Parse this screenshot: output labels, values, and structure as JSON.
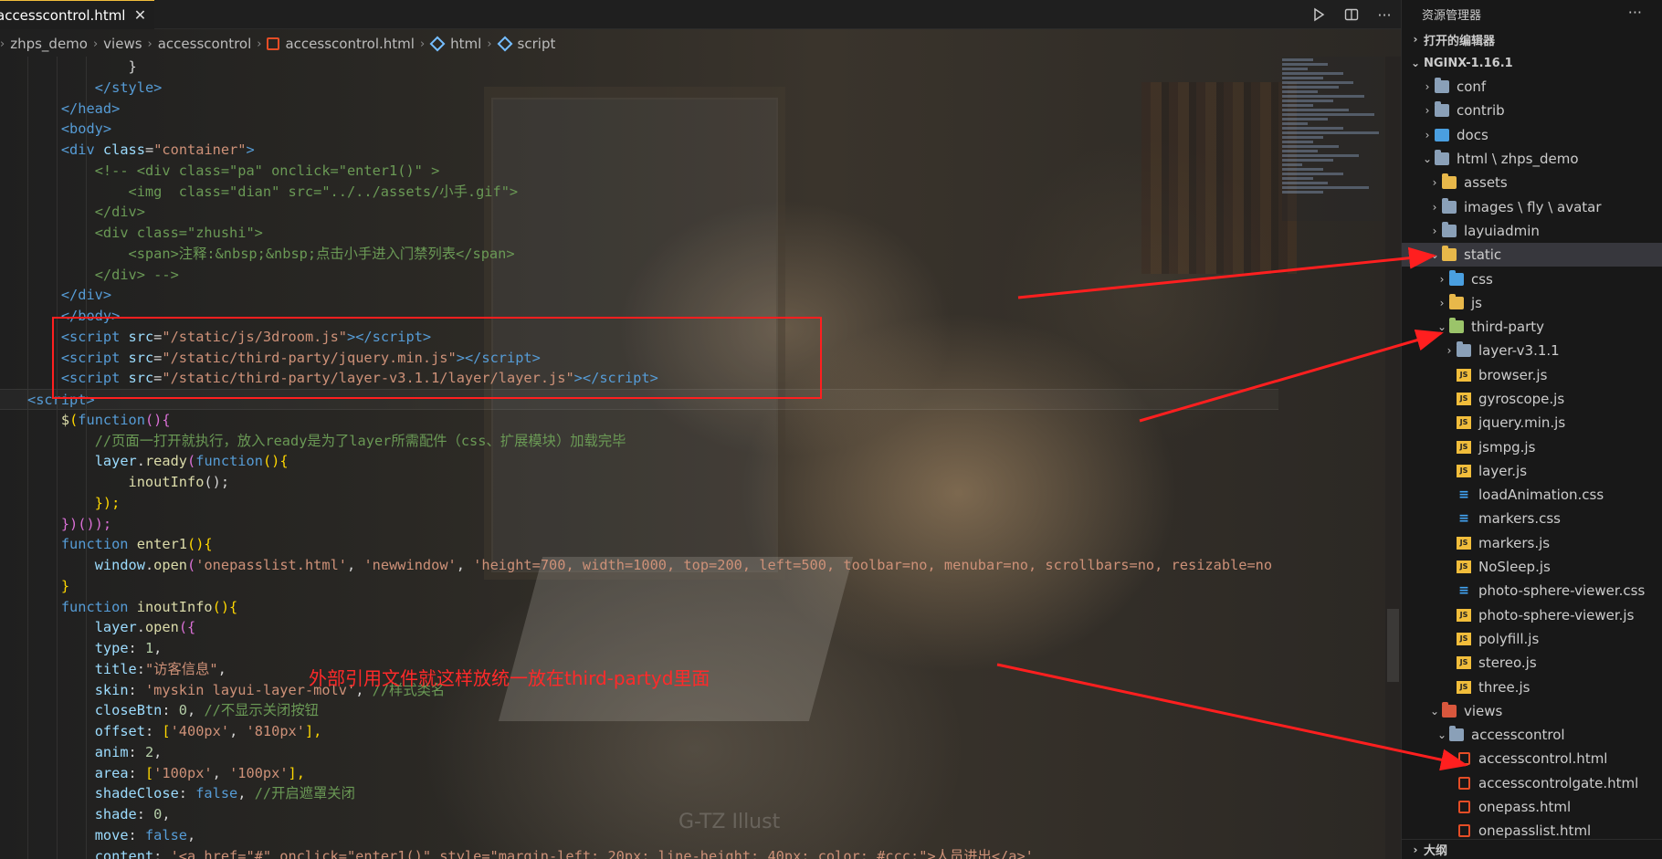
{
  "tab": {
    "label": "accesscontrol.html",
    "close": "✕"
  },
  "editor_actions": [
    "run-icon",
    "split-icon",
    "more-icon"
  ],
  "breadcrumb": [
    {
      "label": "zhps_demo"
    },
    {
      "label": "views"
    },
    {
      "label": "accesscontrol"
    },
    {
      "label": "accesscontrol.html"
    },
    {
      "label": "html"
    },
    {
      "label": "script"
    }
  ],
  "code_lines": [
    [
      {
        "t": "            ",
        "c": "txt"
      },
      {
        "t": "}",
        "c": "txt"
      }
    ],
    [
      {
        "t": "        ",
        "c": "txt"
      },
      {
        "t": "</style>",
        "c": "tag"
      }
    ],
    [
      {
        "t": "    ",
        "c": "txt"
      },
      {
        "t": "</head>",
        "c": "tag"
      }
    ],
    [
      {
        "t": "    ",
        "c": "txt"
      },
      {
        "t": "<body>",
        "c": "tag"
      }
    ],
    [
      {
        "t": "    ",
        "c": "txt"
      },
      {
        "t": "<div ",
        "c": "tag"
      },
      {
        "t": "class",
        "c": "attr"
      },
      {
        "t": "=",
        "c": "pun"
      },
      {
        "t": "\"container\"",
        "c": "str"
      },
      {
        "t": ">",
        "c": "tag"
      }
    ],
    [
      {
        "t": "        ",
        "c": "txt"
      },
      {
        "t": "<!-- <div class=\"pa\" onclick=\"enter1()\" >",
        "c": "cmt"
      }
    ],
    [
      {
        "t": "            ",
        "c": "txt"
      },
      {
        "t": "<img  class=\"dian\" src=\"../../assets/小手.gif\">",
        "c": "cmt"
      }
    ],
    [
      {
        "t": "        ",
        "c": "txt"
      },
      {
        "t": "</div>",
        "c": "cmt"
      }
    ],
    [
      {
        "t": "        ",
        "c": "txt"
      },
      {
        "t": "<div class=\"zhushi\">",
        "c": "cmt"
      }
    ],
    [
      {
        "t": "            ",
        "c": "txt"
      },
      {
        "t": "<span>注释:&nbsp;&nbsp;点击小手进入门禁列表</span>",
        "c": "cmt"
      }
    ],
    [
      {
        "t": "        ",
        "c": "txt"
      },
      {
        "t": "</div> -->",
        "c": "cmt"
      }
    ],
    [
      {
        "t": "    ",
        "c": "txt"
      },
      {
        "t": "</div>",
        "c": "tag"
      }
    ],
    [
      {
        "t": "    ",
        "c": "txt"
      },
      {
        "t": "</body>",
        "c": "tag"
      }
    ],
    [
      {
        "t": "    ",
        "c": "txt"
      },
      {
        "t": "<script ",
        "c": "tag"
      },
      {
        "t": "src",
        "c": "attr"
      },
      {
        "t": "=",
        "c": "pun"
      },
      {
        "t": "\"/static/js/3droom.js\"",
        "c": "str"
      },
      {
        "t": "></",
        "c": "tag"
      },
      {
        "t": "script",
        "c": "tag"
      },
      {
        "t": ">",
        "c": "tag"
      }
    ],
    [
      {
        "t": "    ",
        "c": "txt"
      },
      {
        "t": "<script ",
        "c": "tag"
      },
      {
        "t": "src",
        "c": "attr"
      },
      {
        "t": "=",
        "c": "pun"
      },
      {
        "t": "\"/static/third-party/jquery.min.js\"",
        "c": "str"
      },
      {
        "t": "></",
        "c": "tag"
      },
      {
        "t": "script",
        "c": "tag"
      },
      {
        "t": ">",
        "c": "tag"
      }
    ],
    [
      {
        "t": "    ",
        "c": "txt"
      },
      {
        "t": "<script ",
        "c": "tag"
      },
      {
        "t": "src",
        "c": "attr"
      },
      {
        "t": "=",
        "c": "pun"
      },
      {
        "t": "\"/static/third-party/layer-v3.1.1/layer/layer.js\"",
        "c": "str"
      },
      {
        "t": "></",
        "c": "tag"
      },
      {
        "t": "script",
        "c": "tag"
      },
      {
        "t": ">",
        "c": "tag"
      }
    ],
    [
      {
        "t": "<",
        "c": "tag"
      },
      {
        "t": "script",
        "c": "tag"
      },
      {
        "t": ">",
        "c": "tag"
      }
    ],
    [
      {
        "t": "    ",
        "c": "txt"
      },
      {
        "t": "$",
        "c": "fn"
      },
      {
        "t": "(",
        "c": "yel"
      },
      {
        "t": "function",
        "c": "kw"
      },
      {
        "t": "(){",
        "c": "pink"
      }
    ],
    [
      {
        "t": "        ",
        "c": "txt"
      },
      {
        "t": "//页面一打开就执行，放入ready是为了layer所需配件（css、扩展模块）加载完毕",
        "c": "cmt"
      }
    ],
    [
      {
        "t": "        ",
        "c": "txt"
      },
      {
        "t": "layer",
        "c": "attr"
      },
      {
        "t": ".",
        "c": "pun"
      },
      {
        "t": "ready",
        "c": "fn"
      },
      {
        "t": "(",
        "c": "pink"
      },
      {
        "t": "function",
        "c": "kw"
      },
      {
        "t": "(){",
        "c": "yel"
      }
    ],
    [
      {
        "t": "            ",
        "c": "txt"
      },
      {
        "t": "inoutInfo",
        "c": "fn"
      },
      {
        "t": "();",
        "c": "pun"
      }
    ],
    [
      {
        "t": "        ",
        "c": "txt"
      },
      {
        "t": "});",
        "c": "yel"
      }
    ],
    [
      {
        "t": "    ",
        "c": "txt"
      },
      {
        "t": "})());",
        "c": "pink"
      }
    ],
    [
      {
        "t": "    ",
        "c": "txt"
      },
      {
        "t": "function ",
        "c": "kw"
      },
      {
        "t": "enter1",
        "c": "fn"
      },
      {
        "t": "(){",
        "c": "yel"
      }
    ],
    [
      {
        "t": "        ",
        "c": "txt"
      },
      {
        "t": "window",
        "c": "attr"
      },
      {
        "t": ".",
        "c": "pun"
      },
      {
        "t": "open",
        "c": "fn"
      },
      {
        "t": "(",
        "c": "pink"
      },
      {
        "t": "'onepasslist.html'",
        "c": "str"
      },
      {
        "t": ", ",
        "c": "pun"
      },
      {
        "t": "'newwindow'",
        "c": "str"
      },
      {
        "t": ", ",
        "c": "pun"
      },
      {
        "t": "'height=700, width=1000, top=200, left=500, toolbar=no, menubar=no, scrollbars=no, resizable=no",
        "c": "str"
      }
    ],
    [
      {
        "t": "    ",
        "c": "txt"
      },
      {
        "t": "}",
        "c": "yel"
      }
    ],
    [
      {
        "t": "    ",
        "c": "txt"
      },
      {
        "t": "function ",
        "c": "kw"
      },
      {
        "t": "inoutInfo",
        "c": "fn"
      },
      {
        "t": "(){",
        "c": "yel"
      }
    ],
    [
      {
        "t": "        ",
        "c": "txt"
      },
      {
        "t": "layer",
        "c": "attr"
      },
      {
        "t": ".",
        "c": "pun"
      },
      {
        "t": "open",
        "c": "fn"
      },
      {
        "t": "({",
        "c": "pink"
      }
    ],
    [
      {
        "t": "        ",
        "c": "txt"
      },
      {
        "t": "type",
        "c": "attr"
      },
      {
        "t": ": ",
        "c": "pun"
      },
      {
        "t": "1",
        "c": "num"
      },
      {
        "t": ",",
        "c": "pun"
      }
    ],
    [
      {
        "t": "        ",
        "c": "txt"
      },
      {
        "t": "title",
        "c": "attr"
      },
      {
        "t": ":",
        "c": "pun"
      },
      {
        "t": "\"访客信息\"",
        "c": "str"
      },
      {
        "t": ",",
        "c": "pun"
      }
    ],
    [
      {
        "t": "        ",
        "c": "txt"
      },
      {
        "t": "skin",
        "c": "attr"
      },
      {
        "t": ": ",
        "c": "pun"
      },
      {
        "t": "'myskin layui-layer-molv'",
        "c": "str"
      },
      {
        "t": ", ",
        "c": "pun"
      },
      {
        "t": "//样式类名",
        "c": "cmt"
      }
    ],
    [
      {
        "t": "        ",
        "c": "txt"
      },
      {
        "t": "closeBtn",
        "c": "attr"
      },
      {
        "t": ": ",
        "c": "pun"
      },
      {
        "t": "0",
        "c": "num"
      },
      {
        "t": ", ",
        "c": "pun"
      },
      {
        "t": "//不显示关闭按钮",
        "c": "cmt"
      }
    ],
    [
      {
        "t": "        ",
        "c": "txt"
      },
      {
        "t": "offset",
        "c": "attr"
      },
      {
        "t": ": ",
        "c": "pun"
      },
      {
        "t": "[",
        "c": "yel"
      },
      {
        "t": "'400px'",
        "c": "str"
      },
      {
        "t": ", ",
        "c": "pun"
      },
      {
        "t": "'810px'",
        "c": "str"
      },
      {
        "t": "],",
        "c": "yel"
      }
    ],
    [
      {
        "t": "        ",
        "c": "txt"
      },
      {
        "t": "anim",
        "c": "attr"
      },
      {
        "t": ": ",
        "c": "pun"
      },
      {
        "t": "2",
        "c": "num"
      },
      {
        "t": ",",
        "c": "pun"
      }
    ],
    [
      {
        "t": "        ",
        "c": "txt"
      },
      {
        "t": "area",
        "c": "attr"
      },
      {
        "t": ": ",
        "c": "pun"
      },
      {
        "t": "[",
        "c": "yel"
      },
      {
        "t": "'100px'",
        "c": "str"
      },
      {
        "t": ", ",
        "c": "pun"
      },
      {
        "t": "'100px'",
        "c": "str"
      },
      {
        "t": "],",
        "c": "yel"
      }
    ],
    [
      {
        "t": "        ",
        "c": "txt"
      },
      {
        "t": "shadeClose",
        "c": "attr"
      },
      {
        "t": ": ",
        "c": "pun"
      },
      {
        "t": "false",
        "c": "kw"
      },
      {
        "t": ", ",
        "c": "pun"
      },
      {
        "t": "//开启遮罩关闭",
        "c": "cmt"
      }
    ],
    [
      {
        "t": "        ",
        "c": "txt"
      },
      {
        "t": "shade",
        "c": "attr"
      },
      {
        "t": ": ",
        "c": "pun"
      },
      {
        "t": "0",
        "c": "num"
      },
      {
        "t": ",",
        "c": "pun"
      }
    ],
    [
      {
        "t": "        ",
        "c": "txt"
      },
      {
        "t": "move",
        "c": "attr"
      },
      {
        "t": ": ",
        "c": "pun"
      },
      {
        "t": "false",
        "c": "kw"
      },
      {
        "t": ",",
        "c": "pun"
      }
    ],
    [
      {
        "t": "        ",
        "c": "txt"
      },
      {
        "t": "content",
        "c": "attr"
      },
      {
        "t": ": ",
        "c": "pun"
      },
      {
        "t": "'<a href=\"#\" onclick=\"enter1()\" style=\"margin-left: 20px; line-height: 40px; color: #ccc;\">人员进出</a>'",
        "c": "str"
      }
    ]
  ],
  "annotation_text": "外部引用文件就这样放统一放在third-partyd里面",
  "watermark": "G-TZ Illust",
  "explorer": {
    "title": "资源管理器",
    "open_editors": "打开的编辑器",
    "root": "NGINX-1.16.1",
    "outline": "大纲",
    "items": [
      {
        "label": "conf",
        "indent": 1,
        "chev": "›",
        "icon": "folder",
        "color": "plain"
      },
      {
        "label": "contrib",
        "indent": 1,
        "chev": "›",
        "icon": "folder",
        "color": "plain"
      },
      {
        "label": "docs",
        "indent": 1,
        "chev": "›",
        "icon": "docs",
        "color": "blue"
      },
      {
        "label": "html \\ zhps_demo",
        "indent": 1,
        "chev": "⌄",
        "icon": "folder",
        "color": "plain"
      },
      {
        "label": "assets",
        "indent": 2,
        "chev": "›",
        "icon": "folder",
        "color": "yellow"
      },
      {
        "label": "images \\ fly \\ avatar",
        "indent": 2,
        "chev": "›",
        "icon": "folder",
        "color": "plain"
      },
      {
        "label": "layuiadmin",
        "indent": 2,
        "chev": "›",
        "icon": "folder",
        "color": "plain"
      },
      {
        "label": "static",
        "indent": 2,
        "chev": "⌄",
        "icon": "folder",
        "color": "yellow",
        "selected": true
      },
      {
        "label": "css",
        "indent": 3,
        "chev": "›",
        "icon": "folder",
        "color": "blue"
      },
      {
        "label": "js",
        "indent": 3,
        "chev": "›",
        "icon": "folder",
        "color": "yellow"
      },
      {
        "label": "third-party",
        "indent": 3,
        "chev": "⌄",
        "icon": "folder",
        "color": "green"
      },
      {
        "label": "layer-v3.1.1",
        "indent": 4,
        "chev": "›",
        "icon": "folder",
        "color": "plain"
      },
      {
        "label": "browser.js",
        "indent": 4,
        "chev": "",
        "icon": "js"
      },
      {
        "label": "gyroscope.js",
        "indent": 4,
        "chev": "",
        "icon": "js"
      },
      {
        "label": "jquery.min.js",
        "indent": 4,
        "chev": "",
        "icon": "js"
      },
      {
        "label": "jsmpg.js",
        "indent": 4,
        "chev": "",
        "icon": "js"
      },
      {
        "label": "layer.js",
        "indent": 4,
        "chev": "",
        "icon": "js"
      },
      {
        "label": "loadAnimation.css",
        "indent": 4,
        "chev": "",
        "icon": "css"
      },
      {
        "label": "markers.css",
        "indent": 4,
        "chev": "",
        "icon": "css"
      },
      {
        "label": "markers.js",
        "indent": 4,
        "chev": "",
        "icon": "js"
      },
      {
        "label": "NoSleep.js",
        "indent": 4,
        "chev": "",
        "icon": "js"
      },
      {
        "label": "photo-sphere-viewer.css",
        "indent": 4,
        "chev": "",
        "icon": "css"
      },
      {
        "label": "photo-sphere-viewer.js",
        "indent": 4,
        "chev": "",
        "icon": "js"
      },
      {
        "label": "polyfill.js",
        "indent": 4,
        "chev": "",
        "icon": "js"
      },
      {
        "label": "stereo.js",
        "indent": 4,
        "chev": "",
        "icon": "js"
      },
      {
        "label": "three.js",
        "indent": 4,
        "chev": "",
        "icon": "js"
      },
      {
        "label": "views",
        "indent": 2,
        "chev": "⌄",
        "icon": "folder",
        "color": "red"
      },
      {
        "label": "accesscontrol",
        "indent": 3,
        "chev": "⌄",
        "icon": "folder",
        "color": "plain"
      },
      {
        "label": "accesscontrol.html",
        "indent": 4,
        "chev": "",
        "icon": "html"
      },
      {
        "label": "accesscontrolgate.html",
        "indent": 4,
        "chev": "",
        "icon": "html"
      },
      {
        "label": "onepass.html",
        "indent": 4,
        "chev": "",
        "icon": "html"
      },
      {
        "label": "onepasslist.html",
        "indent": 4,
        "chev": "",
        "icon": "html"
      }
    ]
  }
}
